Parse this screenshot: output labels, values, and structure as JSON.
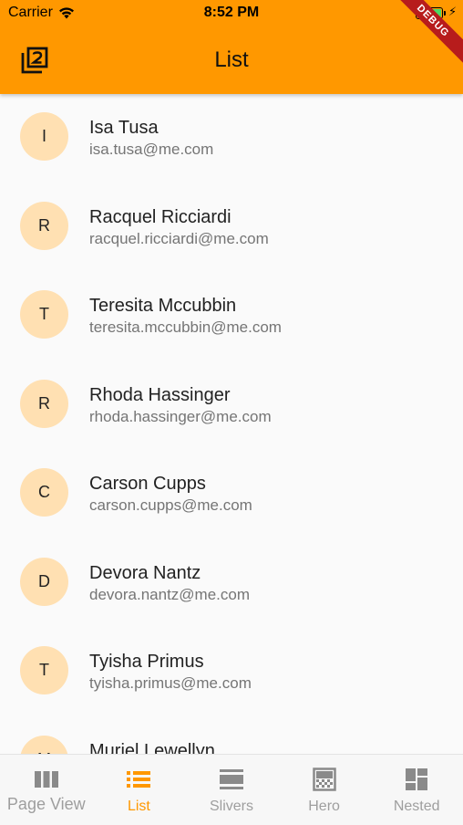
{
  "status_bar": {
    "carrier": "Carrier",
    "time": "8:52 PM"
  },
  "debug_banner": "DEBUG",
  "app_bar": {
    "title": "List",
    "leading_icon": "filter-2-icon"
  },
  "contacts": [
    {
      "initial": "I",
      "name": "Isa Tusa",
      "email": "isa.tusa@me.com"
    },
    {
      "initial": "R",
      "name": "Racquel Ricciardi",
      "email": "racquel.ricciardi@me.com"
    },
    {
      "initial": "T",
      "name": "Teresita Mccubbin",
      "email": "teresita.mccubbin@me.com"
    },
    {
      "initial": "R",
      "name": "Rhoda Hassinger",
      "email": "rhoda.hassinger@me.com"
    },
    {
      "initial": "C",
      "name": "Carson Cupps",
      "email": "carson.cupps@me.com"
    },
    {
      "initial": "D",
      "name": "Devora Nantz",
      "email": "devora.nantz@me.com"
    },
    {
      "initial": "T",
      "name": "Tyisha Primus",
      "email": "tyisha.primus@me.com"
    },
    {
      "initial": "M",
      "name": "Muriel Lewellyn",
      "email": ""
    }
  ],
  "bottom_nav": [
    {
      "label": "Page View",
      "icon": "view-column-icon",
      "active": false
    },
    {
      "label": "List",
      "icon": "list-icon",
      "active": true
    },
    {
      "label": "Slivers",
      "icon": "view-day-icon",
      "active": false
    },
    {
      "label": "Hero",
      "icon": "gradient-icon",
      "active": false
    },
    {
      "label": "Nested",
      "icon": "dashboard-icon",
      "active": false
    }
  ],
  "colors": {
    "app_bar": "#ff9800",
    "avatar": "#ffe0b2",
    "active_nav": "#ff9800",
    "inactive_nav": "#9e9e9e"
  }
}
